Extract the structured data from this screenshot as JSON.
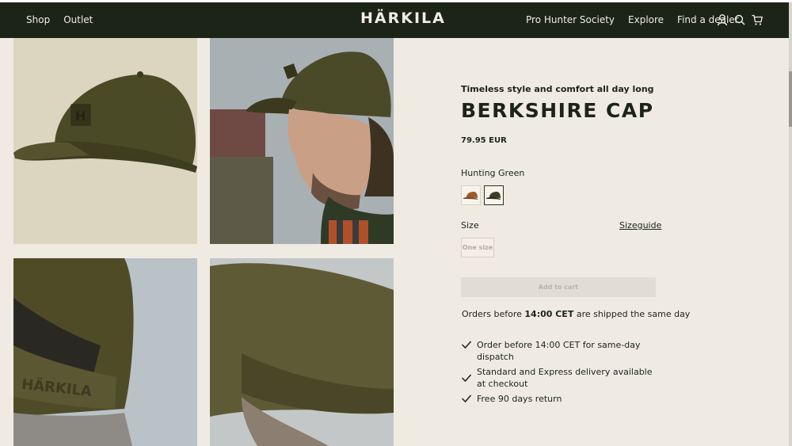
{
  "header": {
    "nav_left": [
      "Shop",
      "Outlet"
    ],
    "logo": "HÄRKILA",
    "nav_right": [
      "Pro Hunter Society",
      "Explore",
      "Find a dealer"
    ],
    "icons": [
      "account-icon",
      "search-icon",
      "cart-icon"
    ]
  },
  "product": {
    "subtitle": "Timeless style and comfort all day long",
    "title": "BERKSHIRE CAP",
    "price": "79.95 EUR",
    "color_label": "Hunting Green",
    "swatches": [
      "brown-cap",
      "hunting-green-cap"
    ],
    "size_label": "Size",
    "size_guide": "Sizeguide",
    "size_option": "One size",
    "add_to_cart": "Add to cart"
  },
  "shipping": {
    "pre": "Orders before ",
    "time": "14:00 CET",
    "post": " are shipped the same day"
  },
  "benefits": [
    "Order before 14:00 CET for same-day dispatch",
    "Standard and Express delivery available at checkout",
    "Free 90 days return"
  ],
  "colors": {
    "header_bg": "#1c2418",
    "page_bg": "#efebe2",
    "text": "#1d2415",
    "cap_green": "#4f4d2b"
  }
}
